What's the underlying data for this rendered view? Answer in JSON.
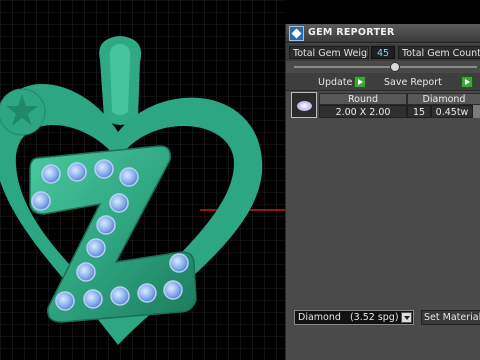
{
  "panel": {
    "title": "GEM REPORTER",
    "total_gem_weight_label": "Total Gem Weight",
    "total_gem_weight_value": "45",
    "total_gem_count_label": "Total Gem Count",
    "update_label": "Update",
    "save_report_label": "Save Report",
    "table": {
      "headers": [
        "Round",
        "Diamond"
      ],
      "row": {
        "size": "2.00 X 2.00",
        "count": "15",
        "weight": "0.45tw"
      }
    },
    "material": {
      "selected": "Diamond",
      "spg": "(3.52 spg)"
    },
    "set_material_label": "Set Material"
  },
  "viewport": {
    "letter": "Z",
    "colors": {
      "background": "#000000",
      "grid": "#3a3a3a",
      "axis": "#c02020",
      "model": "#2fae8a",
      "gem": "#8fb6f0"
    }
  }
}
